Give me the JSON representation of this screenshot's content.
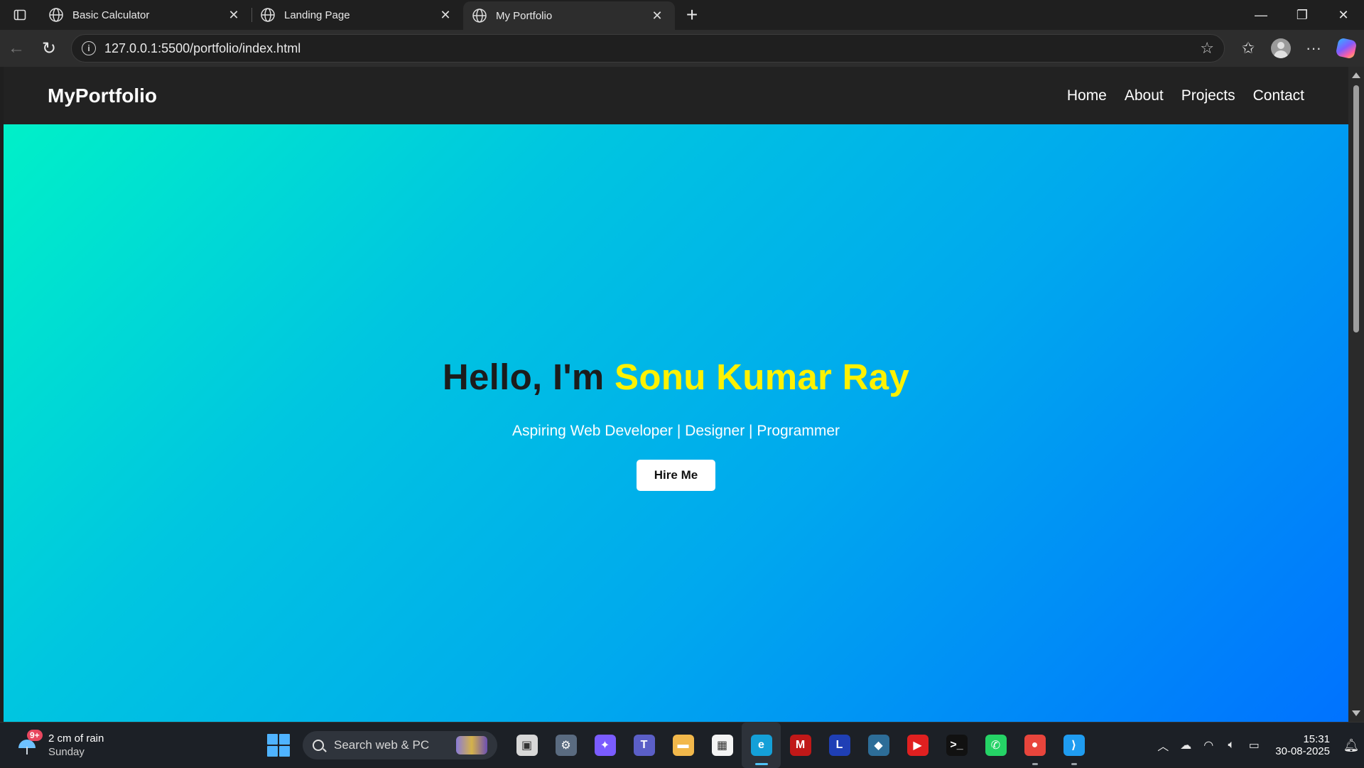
{
  "browser": {
    "tabs": [
      {
        "label": "Basic Calculator",
        "active": false
      },
      {
        "label": "Landing Page",
        "active": false
      },
      {
        "label": "My Portfolio",
        "active": true
      }
    ],
    "url": "127.0.0.1:5500/portfolio/index.html"
  },
  "site": {
    "logo": "MyPortfolio",
    "nav": [
      "Home",
      "About",
      "Projects",
      "Contact"
    ],
    "hero": {
      "greeting": "Hello, I'm ",
      "name": "Sonu Kumar Ray",
      "subtitle": "Aspiring Web Developer | Designer | Programmer",
      "cta": "Hire Me"
    }
  },
  "taskbar": {
    "weather": {
      "badge": "9+",
      "line1": "2 cm of rain",
      "line2": "Sunday"
    },
    "search_label": "Search web & PC",
    "apps": [
      {
        "name": "task-view",
        "glyph": "▣",
        "color": "#d8d8d8"
      },
      {
        "name": "settings",
        "glyph": "⚙",
        "color": "#5a6b80"
      },
      {
        "name": "copilot",
        "glyph": "✦",
        "color": "#7a5cff"
      },
      {
        "name": "teams",
        "glyph": "T",
        "color": "#5b5fc7"
      },
      {
        "name": "file-explorer",
        "glyph": "▬",
        "color": "#f2b84b"
      },
      {
        "name": "microsoft-store",
        "glyph": "▦",
        "color": "#f4f4f4"
      },
      {
        "name": "edge",
        "glyph": "e",
        "color": "#14a0d8"
      },
      {
        "name": "mcafee",
        "glyph": "M",
        "color": "#c01818"
      },
      {
        "name": "lens",
        "glyph": "L",
        "color": "#1f3fb5"
      },
      {
        "name": "mysql-workbench",
        "glyph": "◆",
        "color": "#2d6d98"
      },
      {
        "name": "youtube",
        "glyph": "▶",
        "color": "#e02020"
      },
      {
        "name": "terminal",
        "glyph": ">_",
        "color": "#111111"
      },
      {
        "name": "whatsapp",
        "glyph": "✆",
        "color": "#25d366"
      },
      {
        "name": "chrome",
        "glyph": "●",
        "color": "#e8453c"
      },
      {
        "name": "vscode",
        "glyph": "⟩",
        "color": "#1f9cf0"
      }
    ],
    "active_app": "edge",
    "time": "15:31",
    "date": "30-08-2025"
  }
}
